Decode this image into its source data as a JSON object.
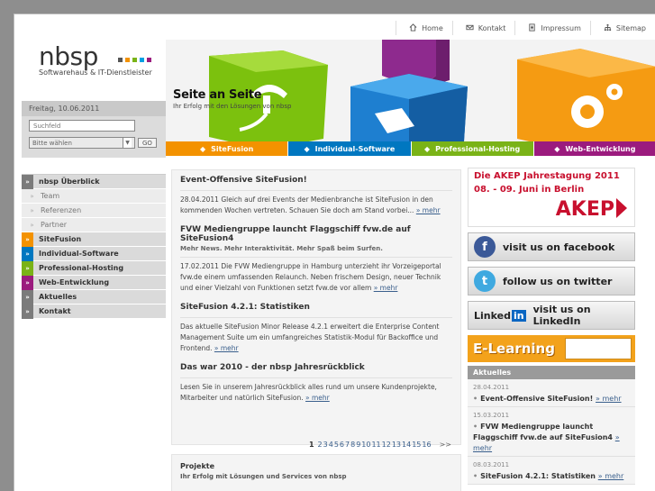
{
  "topnav": [
    {
      "label": "Home",
      "icon": "home-icon"
    },
    {
      "label": "Kontakt",
      "icon": "mail-icon"
    },
    {
      "label": "Impressum",
      "icon": "document-icon"
    },
    {
      "label": "Sitemap",
      "icon": "sitemap-icon"
    }
  ],
  "logo": {
    "text": "nbsp",
    "sub": "Softwarehaus & IT-Dienstleister",
    "dots": [
      "#555555",
      "#f39200",
      "#7ab317",
      "#00a0e3",
      "#9b1b7e"
    ]
  },
  "left": {
    "date": "Freitag, 10.06.2011",
    "search_placeholder": "Suchfeld",
    "select_value": "Bitte wählen",
    "go_label": "GO",
    "menu": [
      {
        "label": "nbsp Überblick",
        "type": "main",
        "color": "#7b7b7b",
        "marker": "»"
      },
      {
        "label": "Team",
        "type": "sub",
        "color": "",
        "marker": "»"
      },
      {
        "label": "Referenzen",
        "type": "sub",
        "color": "",
        "marker": "»"
      },
      {
        "label": "Partner",
        "type": "sub",
        "color": "",
        "marker": "»"
      },
      {
        "label": "SiteFusion",
        "type": "main",
        "color": "#f39200",
        "marker": "»"
      },
      {
        "label": "Individual-Software",
        "type": "main",
        "color": "#0077c0",
        "marker": "»"
      },
      {
        "label": "Professional-Hosting",
        "type": "main",
        "color": "#7ab317",
        "marker": "»"
      },
      {
        "label": "Web-Entwicklung",
        "type": "main",
        "color": "#9b1b7e",
        "marker": "»"
      },
      {
        "label": "Aktuelles",
        "type": "main",
        "color": "#7b7b7b",
        "marker": "»"
      },
      {
        "label": "Kontakt",
        "type": "main",
        "color": "#7b7b7b",
        "marker": "»"
      }
    ]
  },
  "banner": {
    "title": "Seite an Seite",
    "sub": "Ihr Erfolg mit den Lösungen von nbsp",
    "tabs": [
      {
        "label": "SiteFusion",
        "color": "#f39200",
        "icon": "sitefusion-icon"
      },
      {
        "label": "Individual-Software",
        "color": "#0077c0",
        "icon": "puzzle-icon"
      },
      {
        "label": "Professional-Hosting",
        "color": "#7ab317",
        "icon": "plug-icon"
      },
      {
        "label": "Web-Entwicklung",
        "color": "#9b1b7e",
        "icon": "pen-icon"
      }
    ]
  },
  "news": [
    {
      "title": "Event-Offensive SiteFusion!",
      "sub": "",
      "body": "28.04.2011 Gleich auf drei Events der Medienbranche ist SiteFusion in den kommenden Wochen vertreten. Schauen Sie doch am Stand vorbei...",
      "more": "» mehr"
    },
    {
      "title": "FVW Mediengruppe launcht Flaggschiff fvw.de auf SiteFusion4",
      "sub": "Mehr News. Mehr Interaktivität. Mehr Spaß beim Surfen.",
      "body": "17.02.2011 Die FVW Mediengruppe in Hamburg unterzieht ihr Vorzeigeportal fvw.de einem umfassenden Relaunch. Neben frischem Design, neuer Technik und einer Vielzahl von Funktionen setzt fvw.de vor allem",
      "more": "» mehr"
    },
    {
      "title": "SiteFusion 4.2.1: Statistiken",
      "sub": "",
      "body": "Das aktuelle SiteFusion Minor Release 4.2.1 erweitert die Enterprise Content Management Suite um ein umfangreiches Statistik-Modul für Backoffice und Frontend.",
      "more": "» mehr"
    },
    {
      "title": "Das war 2010 - der nbsp Jahresrückblick",
      "sub": "",
      "body": "Lesen Sie in unserem Jahresrückblick alles rund um unsere Kundenprojekte, Mitarbeiter und natürlich SiteFusion.",
      "more": "» mehr"
    }
  ],
  "pager": {
    "pages": [
      "1",
      "2",
      "3",
      "4",
      "5",
      "6",
      "7",
      "8",
      "9",
      "10",
      "11",
      "12",
      "13",
      "14",
      "15",
      "16"
    ],
    "next": ">>"
  },
  "projekte": {
    "title": "Projekte",
    "sub": "Ihr Erfolg mit Lösungen und Services von nbsp"
  },
  "right": {
    "akep_title": "Die AKEP Jahrestagung 2011",
    "akep_date": "08. - 09. Juni in Berlin",
    "akep_logo": "AKEP",
    "facebook": "visit us on facebook",
    "twitter": "follow us on twitter",
    "linkedin_brand": "Linked",
    "linkedin_in": "in",
    "linkedin": "visit us on LinkedIn",
    "elearning": "E-Learning",
    "aktuelle_head": "Aktuelles",
    "aktuelle": [
      {
        "date": "28.04.2011",
        "text": "Event-Offensive SiteFusion!",
        "more": "» mehr"
      },
      {
        "date": "15.03.2011",
        "text": "FVW Mediengruppe launcht Flaggschiff fvw.de auf SiteFusion4",
        "more": "» mehr"
      },
      {
        "date": "08.03.2011",
        "text": "SiteFusion 4.2.1: Statistiken",
        "more": "» mehr"
      }
    ]
  }
}
